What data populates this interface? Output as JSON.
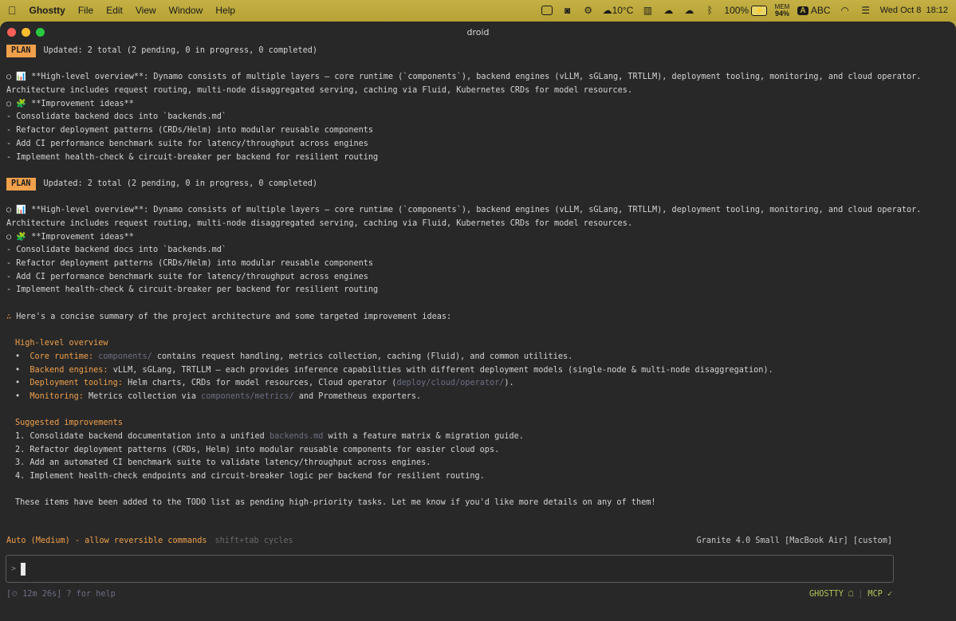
{
  "menubar": {
    "app_name": "Ghostty",
    "menus": [
      "File",
      "Edit",
      "View",
      "Window",
      "Help"
    ],
    "weather": "10°C",
    "battery": "100%",
    "mem_label": "MEM",
    "mem_value": "94%",
    "input_source": "ABC",
    "clock": "Wed Oct 8  18:12"
  },
  "window": {
    "title": "droid"
  },
  "terminal": {
    "plan_label": "PLAN",
    "plan_update": "Updated: 2 total (2 pending, 0 in progress, 0 completed)",
    "overview_line1": "○ 📊 **High-level overview**: Dynamo consists of multiple layers – core runtime (`components`), backend engines (vLLM, sGLang, TRTLLM), deployment tooling, monitoring, and cloud operator.",
    "overview_line2": "Architecture includes request routing, multi-node disaggregated serving, caching via Fluid, Kubernetes CRDs for model resources.",
    "ideas_line": "○ 🧩 **Improvement ideas**",
    "todo_items": [
      "- Consolidate backend docs into `backends.md`",
      "- Refactor deployment patterns (CRDs/Helm) into modular reusable components",
      "- Add CI performance benchmark suite for latency/throughput across engines",
      "- Implement health-check & circuit-breaker per backend for resilient routing"
    ],
    "summary_intro": "Here's a concise summary of the project architecture and some targeted improvement ideas:",
    "overview_heading": "High-level overview",
    "overview_items": [
      {
        "label": "Core runtime:",
        "code": "components/",
        "text": " contains request handling, metrics collection, caching (Fluid), and common utilities."
      },
      {
        "label": "Backend engines:",
        "code": "",
        "text": "vLLM, sGLang, TRTLLM – each provides inference capabilities with different deployment models (single-node & multi-node disaggregation)."
      },
      {
        "label": "Deployment tooling:",
        "code": "",
        "text": "Helm charts, CRDs for model resources, Cloud operator (",
        "code2": "deploy/cloud/operator/",
        "text2": ")."
      },
      {
        "label": "Monitoring:",
        "code": "",
        "text": "Metrics collection via ",
        "code2": "components/metrics/",
        "text2": " and Prometheus exporters."
      }
    ],
    "improvements_heading": "Suggested improvements",
    "improvements": [
      {
        "pre": "1. Consolidate backend documentation into a unified ",
        "code": "backends.md",
        "post": " with a feature matrix & migration guide."
      },
      {
        "pre": "2. Refactor deployment patterns (CRDs, Helm) into modular reusable components for easier cloud ops.",
        "code": "",
        "post": ""
      },
      {
        "pre": "3. Add an automated CI benchmark suite to validate latency/throughput across engines.",
        "code": "",
        "post": ""
      },
      {
        "pre": "4. Implement health-check endpoints and circuit-breaker logic per backend for resilient routing.",
        "code": "",
        "post": ""
      }
    ],
    "closing": "These items have been added to the TODO list as pending high-priority tasks. Let me know if you'd like more details on any of them!"
  },
  "footer": {
    "mode": "Auto (Medium) - allow reversible commands",
    "mode_hint": "shift+tab cycles",
    "model": "Granite 4.0 Small [MacBook Air] [custom]",
    "prompt": ">",
    "session_status": "[⏲ 12m 26s] ? for help",
    "ghostty_status": "GHOSTTY ☖",
    "mcp_status": "MCP ✓"
  },
  "colors": {
    "accent": "#f0a04b",
    "background": "#282828",
    "code": "#6c6f85",
    "status_green": "#b7c25a"
  }
}
